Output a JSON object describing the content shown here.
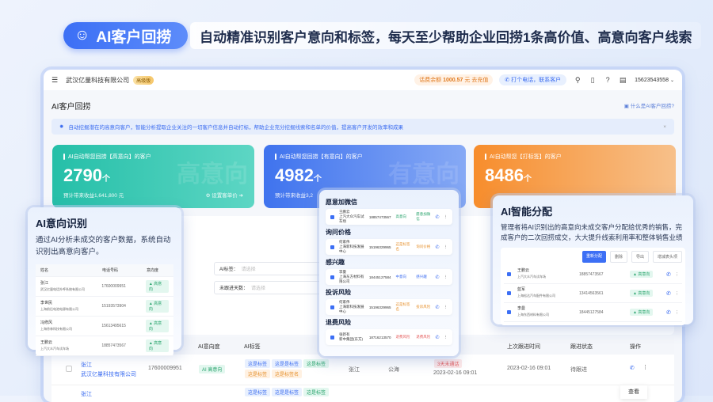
{
  "banner": {
    "pill_label": "AI客户回捞",
    "headline": "自动精准识别客户意向和标签，每天至少帮助企业回捞1条高价值、高意向客户线索"
  },
  "topbar": {
    "company": "武汉亿量科技有限公司",
    "badge": "高级版",
    "fee_label": "话费余额",
    "fee_value": "1000.57",
    "fee_unit": "元",
    "recharge": "去充值",
    "call_button": "打个电话，联系客户",
    "phone": "15623543558"
  },
  "page": {
    "title": "AI客户回捞",
    "help_link": "什么是AI客户回捞?",
    "info": "自动挖掘潜在的高意向客户，智能分析提取企业关注的一切客户信息并自动打标，帮助企业充分挖掘线索和名单的价值，提高客户开发的效率和成果"
  },
  "cards": [
    {
      "title": "AI自动帮您回捞【高意向】的客户",
      "value": "2790",
      "unit": "个",
      "sub": "预计带来收益1,641,800 元",
      "action": "设置客单价",
      "watermark": "高意向",
      "color": "#2fc4ad"
    },
    {
      "title": "AI自动帮您回捞【有意向】的客户",
      "value": "4982",
      "unit": "个",
      "sub": "预计带来收益3,2",
      "watermark": "有意向",
      "color": "#4d7ff0"
    },
    {
      "title": "AI自动帮您【打标签】的客户",
      "value": "8486",
      "unit": "个",
      "color": "#f7953a"
    }
  ],
  "filters": [
    {
      "label": "AI标签：",
      "placeholder": "请选择"
    },
    {
      "label": "未跟进天数：",
      "placeholder": "请选择"
    }
  ],
  "table": {
    "headers": [
      "AI意向度",
      "AI标签",
      "上次跟进时间",
      "跟进状态",
      "操作"
    ],
    "row": {
      "name": "张江",
      "company": "武汉亿量科技有限公司",
      "phone": "17600009951",
      "intent": "AI 高意向",
      "tags": [
        "这是标签",
        "这是是标签",
        "这是标签",
        "这是标签",
        "这是标签名"
      ],
      "owner": "张江",
      "pool": "公海",
      "overdue": "3天未通话",
      "time1": "2023-02-16 09:01",
      "time2": "2023-02-16 09:01",
      "status": "待跟进",
      "menu": "查看"
    },
    "row2_name": "张江",
    "row2_tags": [
      "这是标签",
      "这是是标签",
      "这是标签"
    ]
  },
  "pop_left": {
    "title": "AI意向识别",
    "desc": "通过AI分析未成交的客户数据，系统自动识别出高意向客户。",
    "headers": [
      "姓名",
      "电话号码",
      "意向度"
    ],
    "rows": [
      {
        "name": "张江",
        "company": "武汉亿量电话外呼系统有限公司",
        "phone": "17600009951",
        "tag": "高意向"
      },
      {
        "name": "李世民",
        "company": "上海前后电池电源有限公司",
        "phone": "15193573904",
        "tag": "高意向"
      },
      {
        "name": "冯修风",
        "company": "上海徐林科技有限公司",
        "phone": "15613495615",
        "tag": "高意向"
      },
      {
        "name": "王鹏云",
        "company": "上汽大众汽车试车场",
        "phone": "18857473567",
        "tag": "高意向"
      }
    ]
  },
  "pop_mid": {
    "sections": [
      {
        "title": "愿意加微信",
        "name": "王鹏云",
        "company": "上汽大众汽车试车场",
        "phone": "18857473567",
        "tag1": "高意向",
        "tag2": "愿意加微信",
        "c1": "#27a36b",
        "c2": "#27a36b"
      },
      {
        "title": "询问价格",
        "name": "何家伟",
        "company": "上海新科技发展中心",
        "phone": "15196329965",
        "tag1": "这是标签名",
        "tag2": "询问价格",
        "c1": "#e6912e",
        "c2": "#e6912e"
      },
      {
        "title": "感兴趣",
        "name": "李曼",
        "company": "上海东方材料有限公司",
        "phone": "18445127584",
        "tag1": "中意向",
        "tag2": "感兴趣",
        "c1": "#3b6cf0",
        "c2": "#3b6cf0"
      },
      {
        "title": "投诉风险",
        "name": "何家伟",
        "company": "上海新科技发展中心",
        "phone": "15196329965",
        "tag1": "这是标签名",
        "tag2": "投诉风险",
        "c1": "#e6912e",
        "c2": "#e6912e"
      },
      {
        "title": "退费风险",
        "name": "张新有",
        "company": "新中集团(东方)",
        "phone": "18716213570",
        "tag1": "退费风险",
        "tag2": "退费风险",
        "c1": "#e45a5a",
        "c2": "#e45a5a"
      }
    ]
  },
  "pop_right": {
    "title": "AI智能分配",
    "desc": "管理者将AI识别出的高意向未成交客户分配给优秀的销售，完成客户的二次回捞成交，大大提升线索利用率和整体销售业绩",
    "buttons": [
      "重新分配",
      "删除",
      "导出",
      "增减表头项"
    ],
    "rows": [
      {
        "name": "王鹏云",
        "company": "上汽大众汽车试车场",
        "phone": "18857473567",
        "tag": "高意向"
      },
      {
        "name": "蓝军",
        "company": "上海松达汽车配件有限公司",
        "phone": "13414563561",
        "tag": "高意向"
      },
      {
        "name": "李曼",
        "company": "上海东西材料有限公司",
        "phone": "18445127584",
        "tag": "高意向"
      }
    ]
  }
}
